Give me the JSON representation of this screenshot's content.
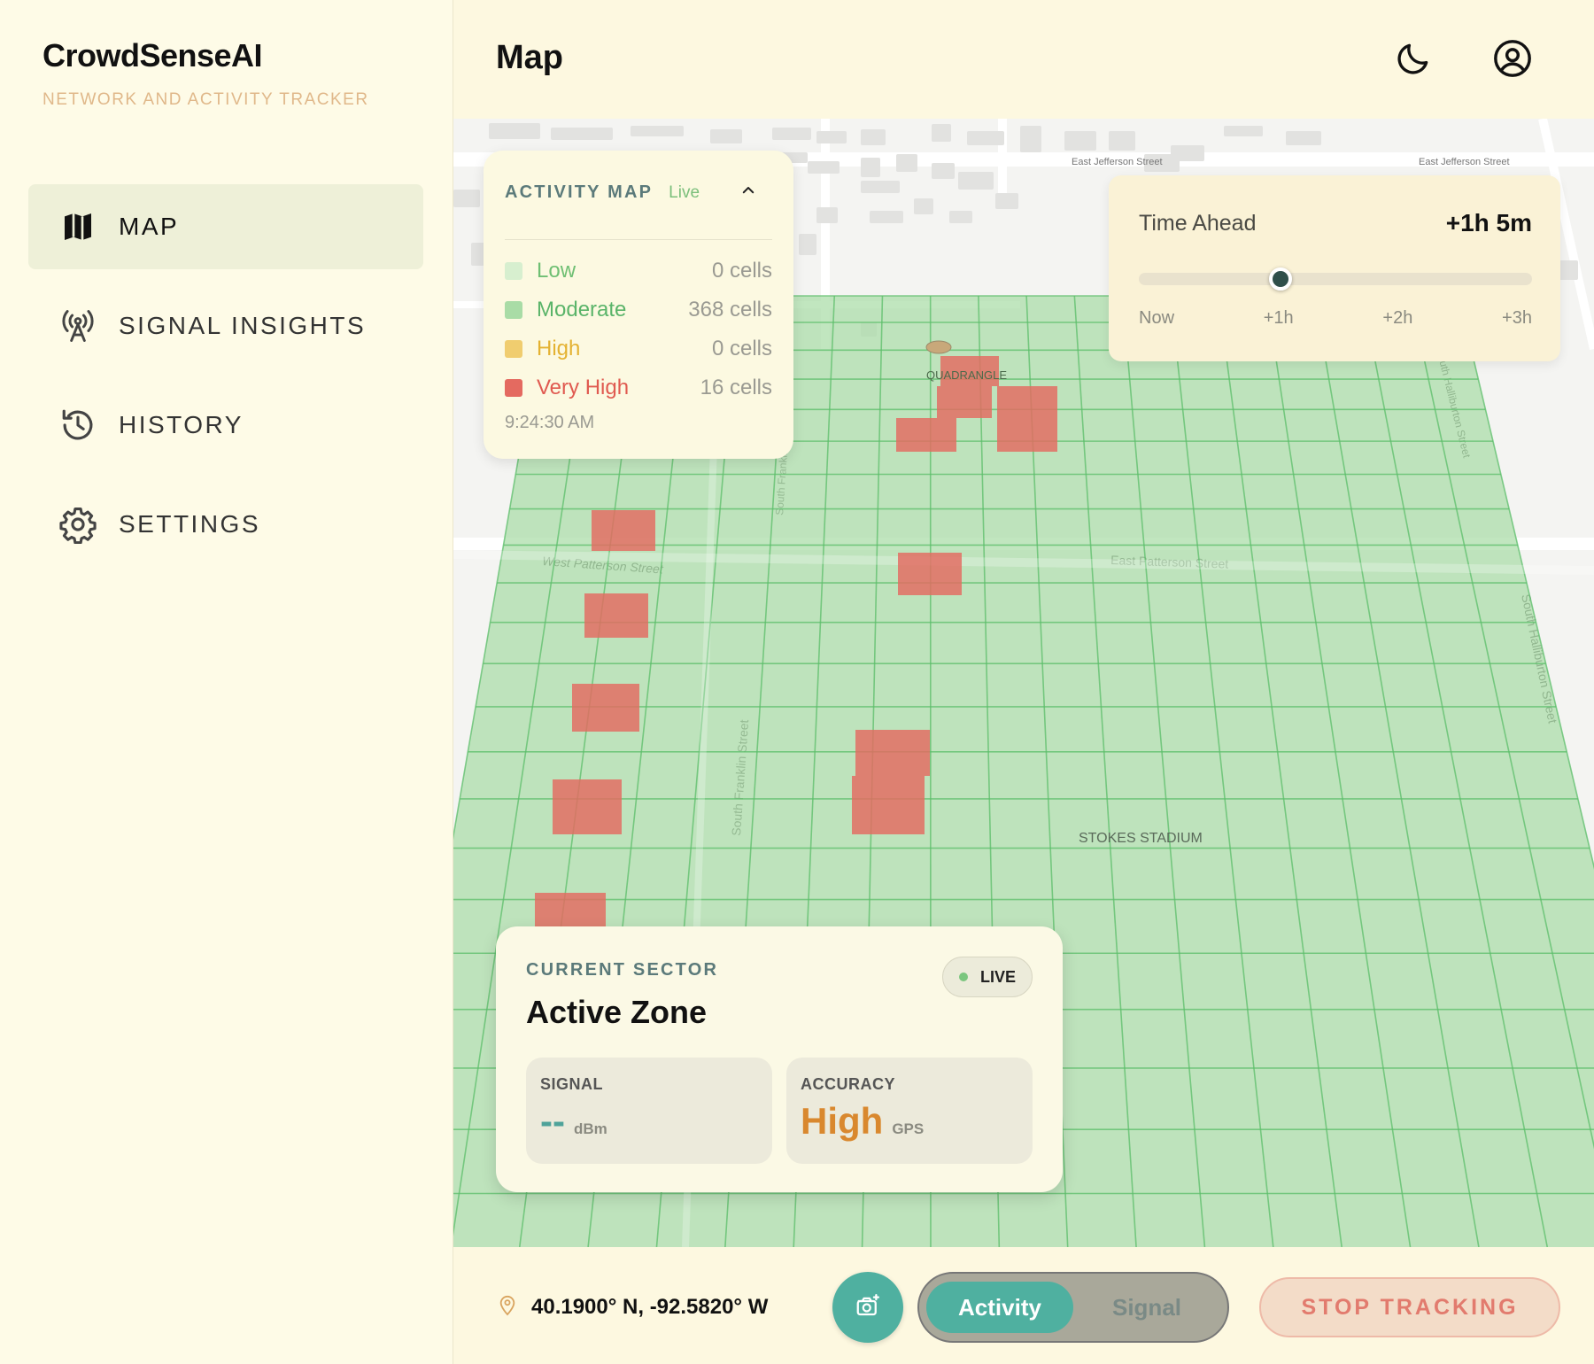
{
  "app": {
    "brand": "CrowdSenseAI",
    "tagline": "NETWORK AND ACTIVITY TRACKER"
  },
  "sidebar": {
    "items": [
      {
        "label": "MAP",
        "icon": "map-icon",
        "active": true
      },
      {
        "label": "SIGNAL INSIGHTS",
        "icon": "antenna-icon",
        "active": false
      },
      {
        "label": "HISTORY",
        "icon": "history-icon",
        "active": false
      },
      {
        "label": "SETTINGS",
        "icon": "gear-icon",
        "active": false
      }
    ]
  },
  "header": {
    "title": "Map",
    "theme_icon": "moon-icon",
    "account_icon": "user-circle-icon"
  },
  "map": {
    "street_labels": [
      "East Jefferson Street",
      "East Jefferson Street",
      "South Franklin Street",
      "South Franklin Street",
      "South Franklin Street",
      "West Patterson Street",
      "East Patterson Street",
      "South Halliburton Street",
      "South Halliburton Street",
      "QUADRANGLE",
      "STOKES STADIUM"
    ]
  },
  "legend": {
    "title": "ACTIVITY MAP",
    "status": "Live",
    "rows": [
      {
        "label": "Low",
        "count": "0 cells",
        "color": "#d7efcf",
        "text_color": "#6fbf73"
      },
      {
        "label": "Moderate",
        "count": "368 cells",
        "color": "#a9dca6",
        "text_color": "#5ab469"
      },
      {
        "label": "High",
        "count": "0 cells",
        "color": "#f0cd6f",
        "text_color": "#e4b232"
      },
      {
        "label": "Very High",
        "count": "16 cells",
        "color": "#e46a60",
        "text_color": "#e05a50"
      }
    ],
    "timestamp": "9:24:30 AM"
  },
  "time_ahead": {
    "label": "Time Ahead",
    "value": "+1h 5m",
    "fraction": 0.36,
    "ticks": [
      "Now",
      "+1h",
      "+2h",
      "+3h"
    ]
  },
  "sector": {
    "label": "CURRENT SECTOR",
    "name": "Active Zone",
    "badge": "LIVE",
    "signal": {
      "label": "SIGNAL",
      "value": "--",
      "unit": "dBm",
      "color": "#4fa39a"
    },
    "accuracy": {
      "label": "ACCURACY",
      "value": "High",
      "unit": "GPS",
      "color": "#d9882e"
    }
  },
  "bottombar": {
    "coordinates": "40.1900° N, -92.5820° W",
    "camera_icon": "camera-icon",
    "mode_options": [
      "Activity",
      "Signal"
    ],
    "active_mode": "Activity",
    "stop_label": "STOP TRACKING"
  },
  "colors": {
    "accent": "#4fb0a0",
    "grid_green": "#a9dca6",
    "hot_red": "#e46a60"
  }
}
